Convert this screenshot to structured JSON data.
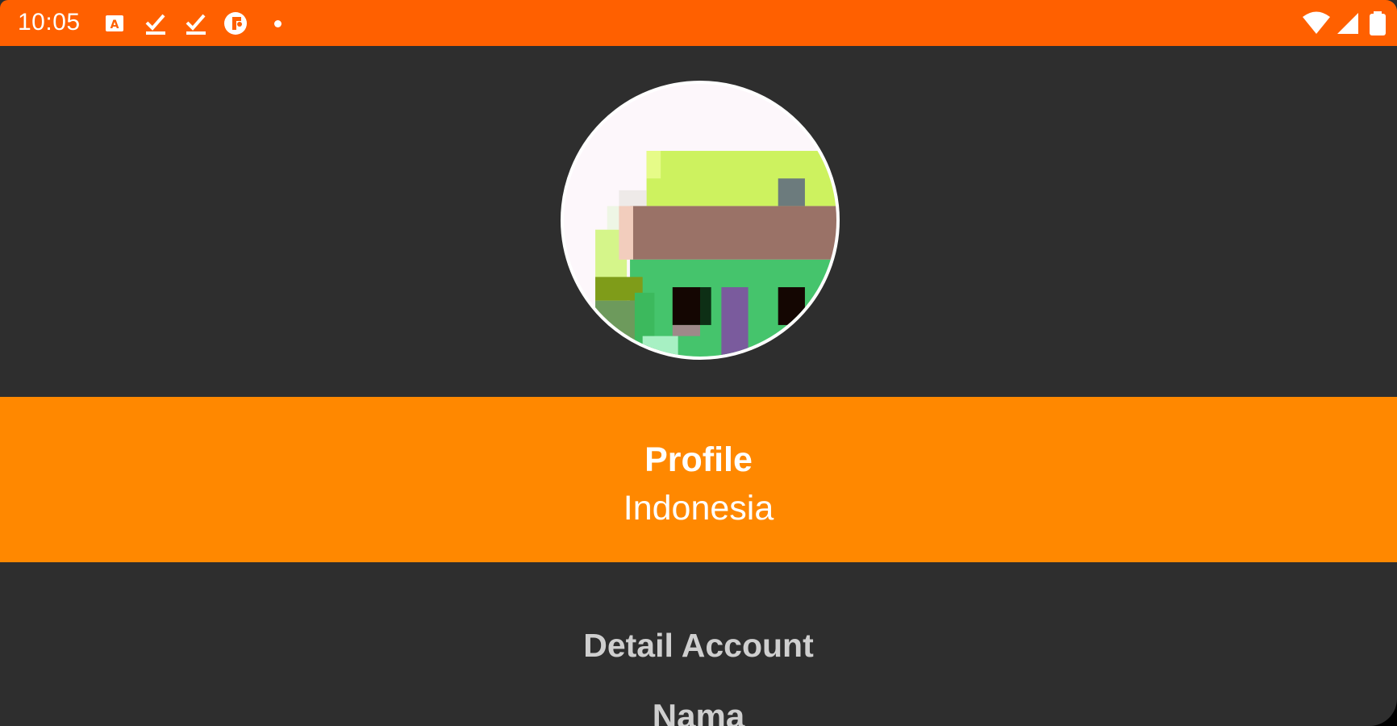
{
  "status_bar": {
    "time": "10:05",
    "left_icons": [
      "keyboard-icon",
      "download-done-icon",
      "download-done-icon",
      "app-notification-icon",
      "dot-icon"
    ],
    "right_icons": [
      "wifi-icon",
      "cell-signal-icon",
      "battery-icon"
    ],
    "color": "#ff6000"
  },
  "header": {
    "avatar_icon": "pixel-avatar"
  },
  "banner": {
    "title": "Profile",
    "subtitle": "Indonesia",
    "color": "#ff8800"
  },
  "detail": {
    "heading": "Detail Account",
    "first_field_label": "Nama"
  },
  "colors": {
    "background": "#2e2e2e",
    "text_muted": "#cfcfcf"
  }
}
